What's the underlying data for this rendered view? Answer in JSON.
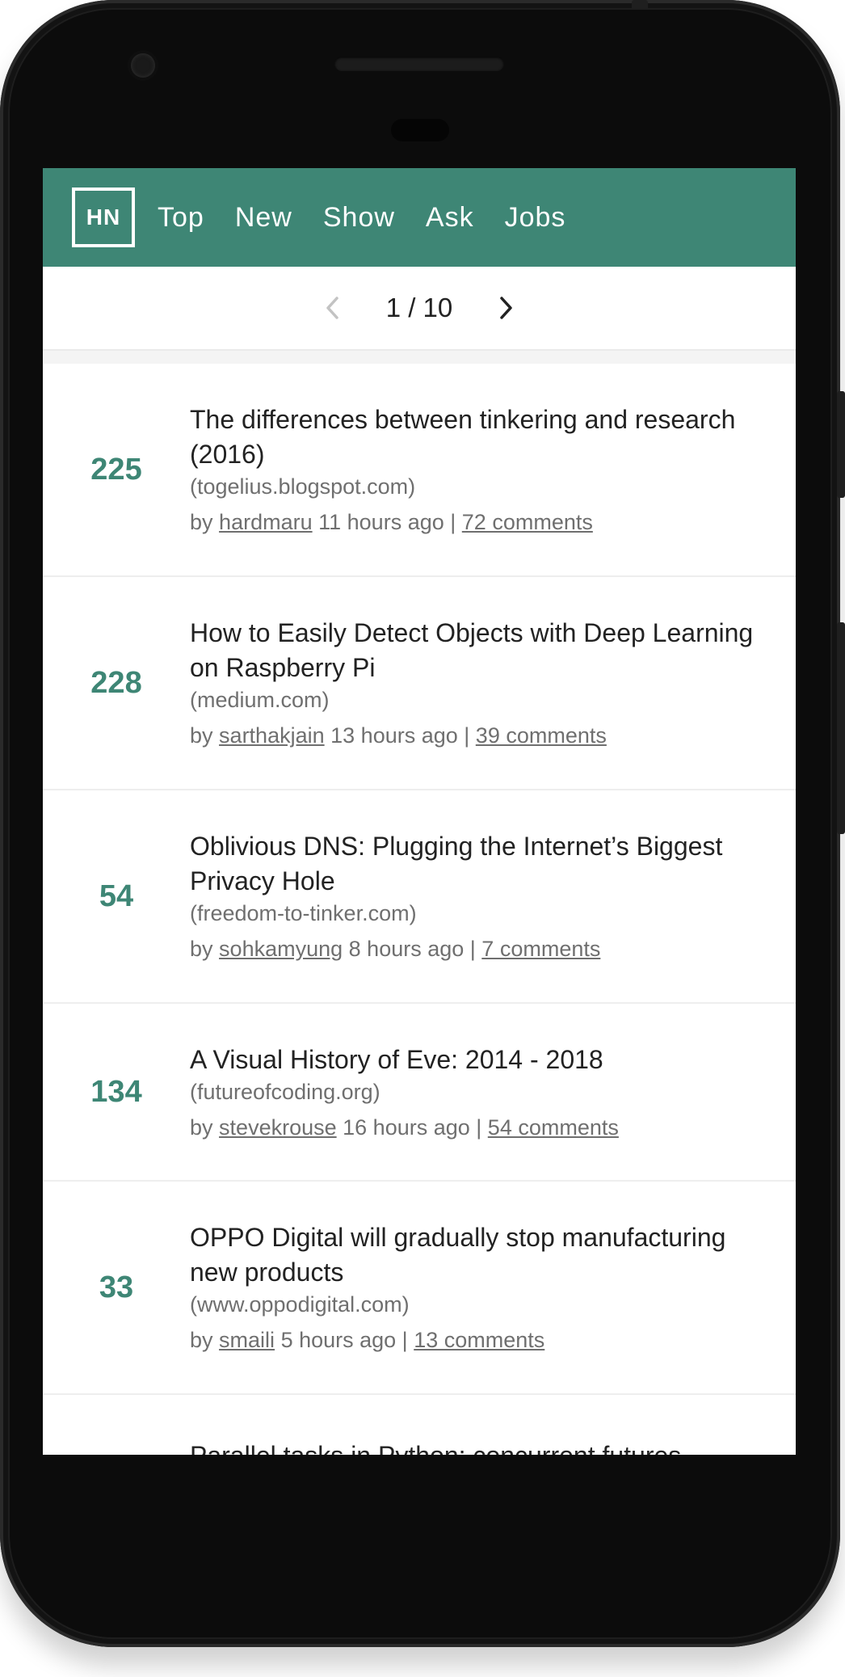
{
  "header": {
    "logo": "HN",
    "nav": [
      "Top",
      "New",
      "Show",
      "Ask",
      "Jobs"
    ]
  },
  "pager": {
    "prev_icon": "chevron-left-icon",
    "next_icon": "chevron-right-icon",
    "text": "1 / 10"
  },
  "colors": {
    "brand": "#3e8675",
    "text": "#222222",
    "muted": "#6f6f6f"
  },
  "stories": [
    {
      "score": "225",
      "title": "The differences between tinkering and research (2016)",
      "domain": "(togelius.blogspot.com)",
      "by": "by",
      "user": "hardmaru",
      "time": "11 hours ago |",
      "comments": "72 comments"
    },
    {
      "score": "228",
      "title": "How to Easily Detect Objects with Deep Learning on Raspberry Pi",
      "domain": "(medium.com)",
      "by": "by",
      "user": "sarthakjain",
      "time": "13 hours ago |",
      "comments": "39 comments"
    },
    {
      "score": "54",
      "title": "Oblivious DNS: Plugging the Internet’s Biggest Privacy Hole",
      "domain": "(freedom-to-tinker.com)",
      "by": "by",
      "user": "sohkamyung",
      "time": "8 hours ago |",
      "comments": "7 comments"
    },
    {
      "score": "134",
      "title": "A Visual History of Eve: 2014 - 2018",
      "domain": "(futureofcoding.org)",
      "by": "by",
      "user": "stevekrouse",
      "time": "16 hours ago |",
      "comments": "54 comments"
    },
    {
      "score": "33",
      "title": "OPPO Digital will gradually stop manufacturing new products",
      "domain": "(www.oppodigital.com)",
      "by": "by",
      "user": "smaili",
      "time": "5 hours ago |",
      "comments": "13 comments"
    }
  ],
  "partial_story": {
    "title": "Parallel tasks in Python: concurrent.futures"
  }
}
